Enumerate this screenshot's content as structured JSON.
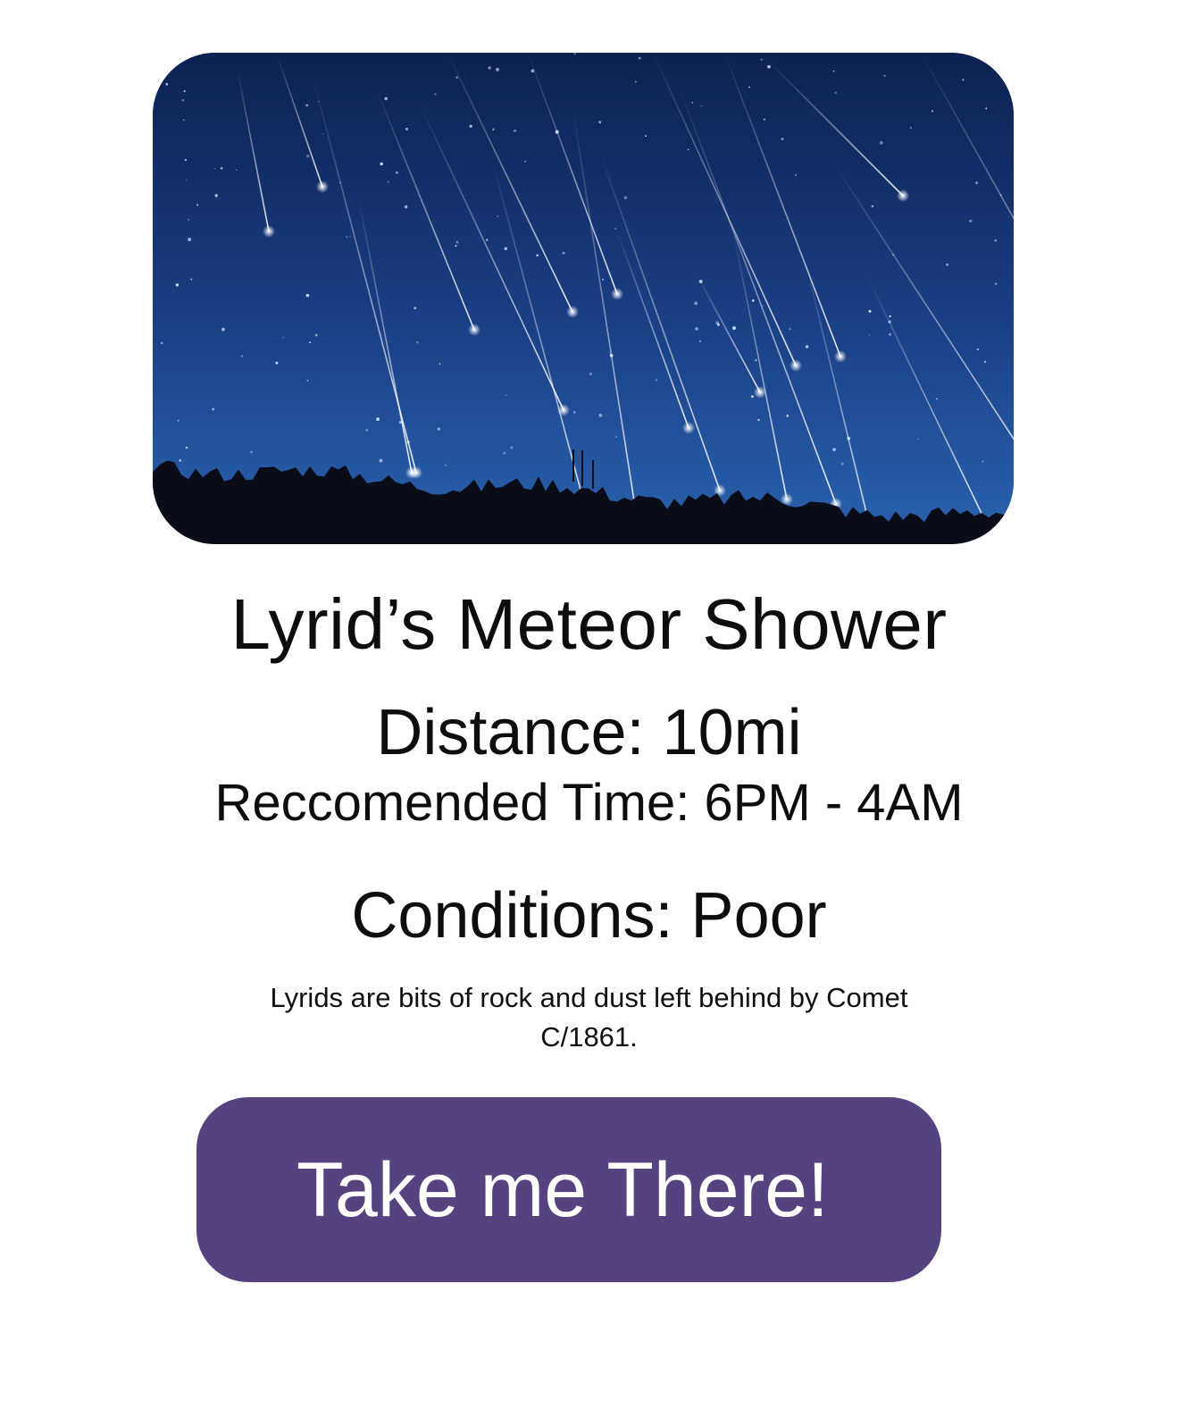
{
  "hero_image": {
    "description_icon": "meteor-shower-night-sky-photo",
    "colors": {
      "sky_top": "#0d2150",
      "sky_bottom": "#2a63b0",
      "horizon": "#0a0d18"
    }
  },
  "event": {
    "title": "Lyrid’s Meteor Shower",
    "distance": "Distance: 10mi",
    "recommended_time": "Reccomended Time: 6PM - 4AM",
    "conditions": "Conditions: Poor",
    "description": "Lyrids are bits of rock and dust left behind by Comet C/1861."
  },
  "cta": {
    "label": "Take me There!",
    "color": "#56427f"
  }
}
